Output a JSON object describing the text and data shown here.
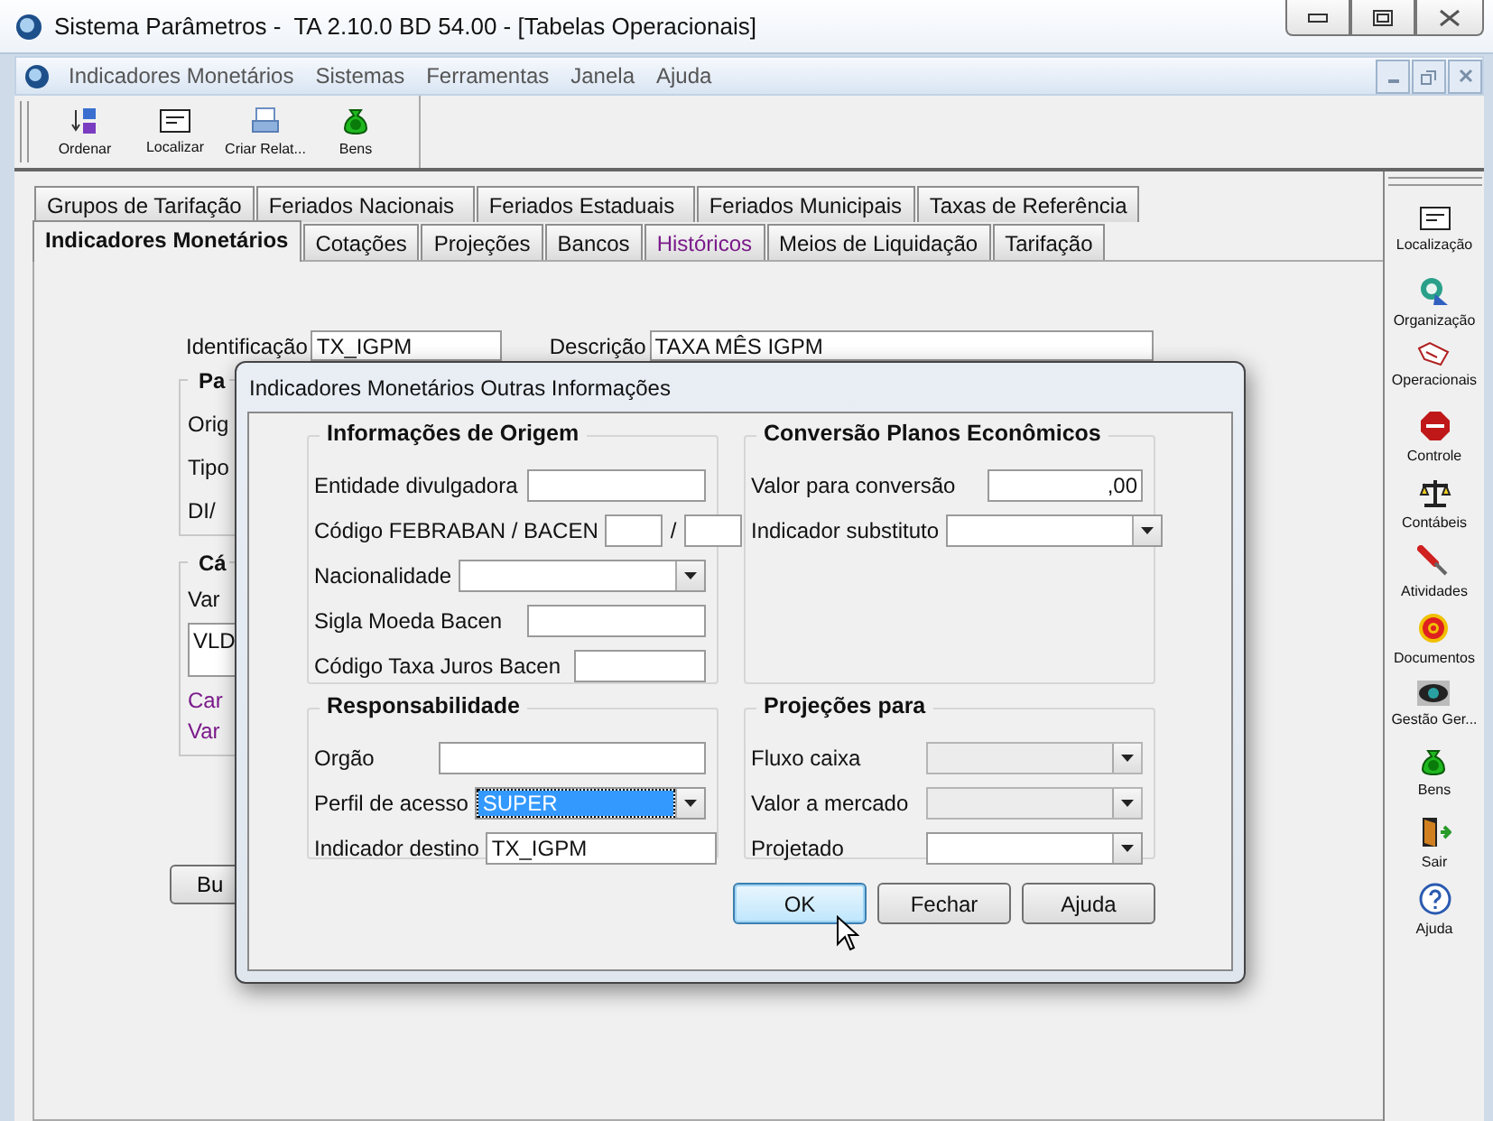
{
  "window": {
    "title": "Sistema Parâmetros -  TA 2.10.0 BD 54.00 - [Tabelas Operacionais]"
  },
  "menu": [
    {
      "label": "Indicadores Monetários"
    },
    {
      "label": "Sistemas"
    },
    {
      "label": "Ferramentas"
    },
    {
      "label": "Janela"
    },
    {
      "label": "Ajuda"
    }
  ],
  "toolbar": [
    {
      "kind": "sort",
      "label": "Ordenar"
    },
    {
      "kind": "find",
      "label": "Localizar"
    },
    {
      "kind": "report",
      "label": "Criar Relat..."
    },
    {
      "kind": "money",
      "label": "Bens"
    }
  ],
  "tabs": {
    "row_1": [
      {
        "label": "Grupos de Tarifação",
        "selected": false,
        "visited": false
      },
      {
        "label": "Feriados Nacionais",
        "selected": false,
        "visited": false
      },
      {
        "label": "Feriados Estaduais",
        "selected": false,
        "visited": false
      },
      {
        "label": "Feriados Municipais",
        "selected": false,
        "visited": false
      },
      {
        "label": "Taxas de Referência",
        "selected": false,
        "visited": false
      }
    ],
    "row_2": [
      {
        "label": "Indicadores Monetários",
        "selected": true,
        "visited": false
      },
      {
        "label": "Cotações",
        "selected": false,
        "visited": false
      },
      {
        "label": "Projeções",
        "selected": false,
        "visited": false
      },
      {
        "label": "Bancos",
        "selected": false,
        "visited": false
      },
      {
        "label": "Históricos",
        "selected": false,
        "visited": true
      },
      {
        "label": "Meios de Liquidação",
        "selected": false,
        "visited": false
      },
      {
        "label": "Tarifação",
        "selected": false,
        "visited": false
      }
    ]
  },
  "form": {
    "identificacao": {
      "label": "Identificação",
      "value": "TX_IGPM"
    },
    "descricao": {
      "label": "Descrição",
      "value": "TAXA MÊS IGPM"
    },
    "group_1": {
      "title": "Pa",
      "labels": [
        "Orig",
        "Tipo",
        "DI/"
      ]
    },
    "group_2": {
      "title": "Cá",
      "label": "Var",
      "value": "VLD",
      "links": [
        "Car",
        "Var"
      ]
    },
    "button": "Bu"
  },
  "sidebar": [
    {
      "kind": "find",
      "label": "Localização"
    },
    {
      "kind": "org",
      "label": "Organização"
    },
    {
      "kind": "hand",
      "label": "Operacionais"
    },
    {
      "kind": "stop",
      "label": "Controle"
    },
    {
      "kind": "scale",
      "label": "Contábeis"
    },
    {
      "kind": "tool",
      "label": "Atividades"
    },
    {
      "kind": "target",
      "label": "Documentos"
    },
    {
      "kind": "eye",
      "label": "Gestão Ger..."
    },
    {
      "kind": "money",
      "label": "Bens"
    },
    {
      "kind": "door",
      "label": "Sair"
    },
    {
      "kind": "help",
      "label": "Ajuda"
    }
  ],
  "dialog": {
    "title": "Indicadores Monetários Outras Informações",
    "groups": [
      {
        "title": "Informações de Origem",
        "fields": [
          {
            "kind": "text",
            "label": "Entidade divulgadora"
          },
          {
            "kind": "pair",
            "label": "Código FEBRABAN / BACEN",
            "separator": "/"
          },
          {
            "kind": "combo",
            "label": "Nacionalidade",
            "disabled": false
          },
          {
            "kind": "text",
            "label": "Sigla Moeda Bacen"
          },
          {
            "kind": "short",
            "label": "Código Taxa Juros Bacen"
          }
        ]
      },
      {
        "title": "Conversão Planos Econômicos",
        "fields": [
          {
            "kind": "number",
            "label": "Valor para conversão",
            "value": ",00"
          },
          {
            "kind": "combo",
            "label": "Indicador substituto",
            "disabled": false
          }
        ]
      },
      {
        "title": "Responsabilidade",
        "fields": [
          {
            "kind": "wide",
            "label": "Orgão"
          },
          {
            "kind": "combo",
            "label": "Perfil de acesso",
            "value": "SUPER",
            "highlighted": true,
            "disabled": false
          },
          {
            "kind": "wide",
            "label": "Indicador destino",
            "value": "TX_IGPM",
            "highlighted": false
          }
        ]
      },
      {
        "title": "Projeções para",
        "fields": [
          {
            "kind": "combo",
            "label": "Fluxo caixa",
            "disabled": true
          },
          {
            "kind": "combo",
            "label": "Valor a mercado",
            "disabled": true
          },
          {
            "kind": "combo",
            "label": "Projetado",
            "disabled": false
          }
        ]
      }
    ],
    "buttons": [
      {
        "label": "OK",
        "default": true
      },
      {
        "label": "Fechar",
        "default": false
      },
      {
        "label": "Ajuda",
        "default": false
      }
    ]
  }
}
